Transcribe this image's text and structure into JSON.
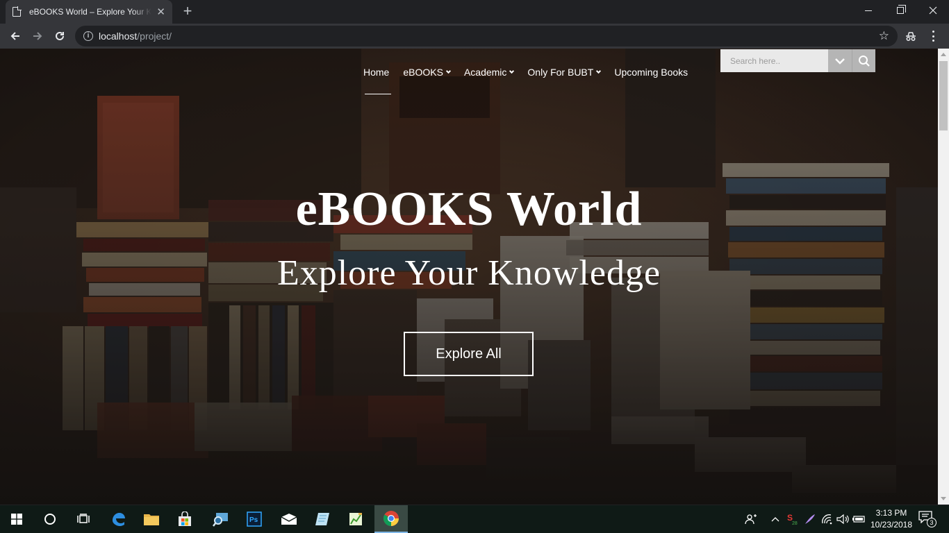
{
  "browser": {
    "tab_title": "eBOOKS World – Explore Your Knowledge",
    "tab_close": "✕",
    "new_tab": "+",
    "url_host": "localhost",
    "url_path": "/project/"
  },
  "nav": {
    "items": [
      {
        "label": "Home",
        "dropdown": false
      },
      {
        "label": "eBOOKS",
        "dropdown": true
      },
      {
        "label": "Academic",
        "dropdown": true
      },
      {
        "label": "Only For BUBT",
        "dropdown": true
      },
      {
        "label": "Upcoming Books",
        "dropdown": false
      }
    ],
    "active": "Home"
  },
  "search": {
    "placeholder": "Search here.."
  },
  "hero": {
    "title": "eBOOKS World",
    "subtitle": "Explore Your Knowledge",
    "button_label": "Explore All"
  },
  "taskbar": {
    "apps": [
      "windows-start",
      "cortana",
      "task-view",
      "edge",
      "file-explorer",
      "store",
      "magnifier-app",
      "photoshop",
      "mail",
      "notepad-app",
      "charts-app",
      "chrome"
    ],
    "active_app": "chrome",
    "clock_time": "3:13 PM",
    "clock_date": "10/23/2018",
    "notification_count": "3"
  },
  "colors": {
    "chrome_dark": "#202124",
    "chrome_toolbar": "#35363a",
    "search_bg": "#e9e9e9",
    "search_button": "#b5b5b5",
    "taskbar": "#0f1a16"
  }
}
